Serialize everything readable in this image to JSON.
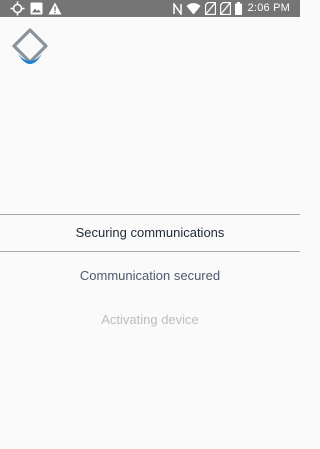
{
  "status_bar": {
    "time": "2:06 PM",
    "left_icons": [
      "gps-icon",
      "image-icon",
      "warning-icon"
    ],
    "right_icons": [
      "nfc-icon",
      "wifi-icon",
      "no-sim-icon",
      "no-sim-icon",
      "battery-icon"
    ]
  },
  "app": {
    "logo_icon": "app-logo-icon"
  },
  "steps": {
    "current": "Securing communications",
    "completed": "Communication secured",
    "pending": "Activating device"
  },
  "colors": {
    "status_bar_bg": "#757575",
    "background": "#fafafa",
    "logo_blue": "#1a7fd0",
    "logo_gray": "#8a939c",
    "current_text": "#1f2a36",
    "completed_text": "#4d5a6a",
    "pending_text": "#bdbdbd"
  }
}
